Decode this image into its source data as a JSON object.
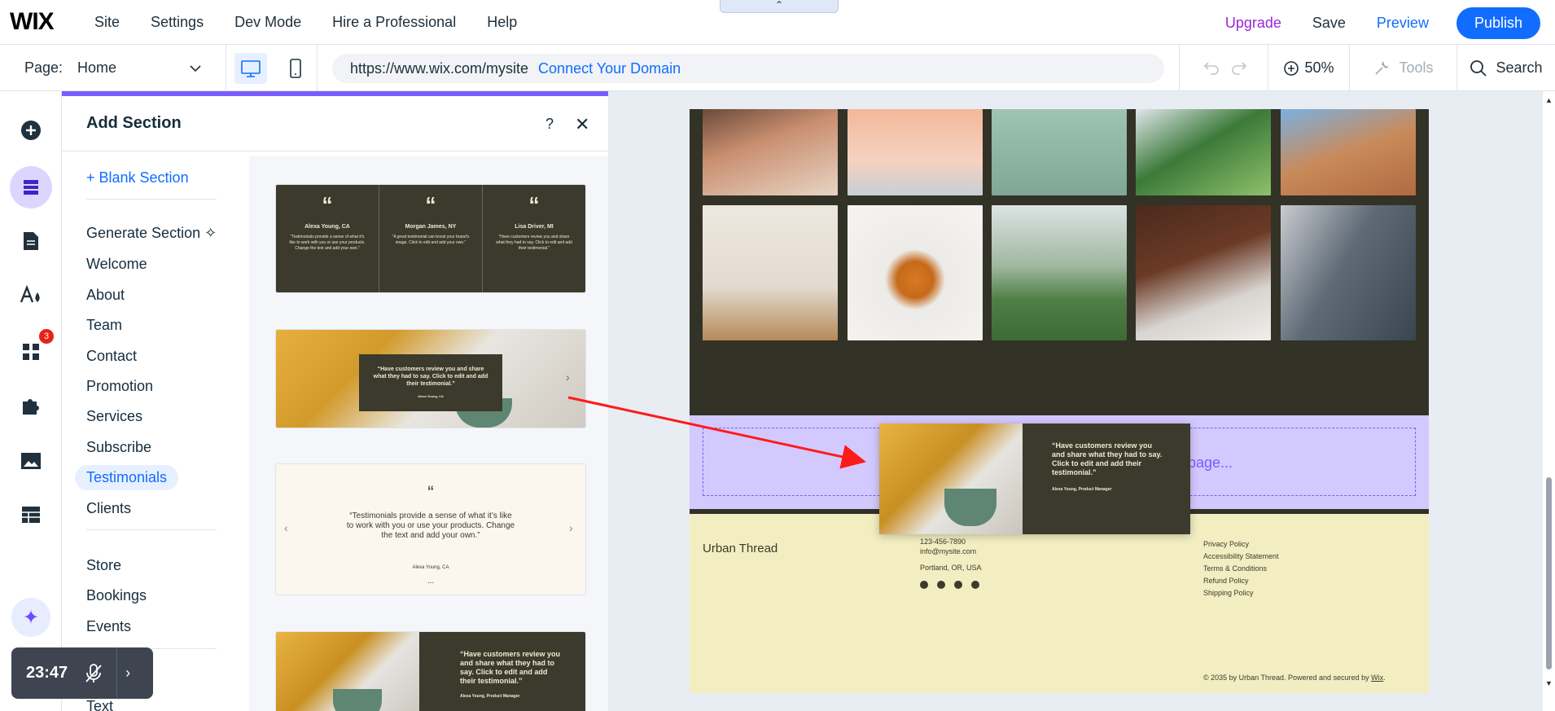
{
  "topbar": {
    "logo": "WIX",
    "menu": [
      "Site",
      "Settings",
      "Dev Mode",
      "Hire a Professional",
      "Help"
    ],
    "upgrade": "Upgrade",
    "save": "Save",
    "preview": "Preview",
    "publish": "Publish"
  },
  "bar2": {
    "page_label": "Page:",
    "page_value": "Home",
    "url": "https://www.wix.com/mysite",
    "connect_domain": "Connect Your Domain",
    "zoom": "50%",
    "tools": "Tools",
    "search": "Search"
  },
  "rail": {
    "apps_badge": "3"
  },
  "panel": {
    "title": "Add Section",
    "help": "?",
    "close": "✕",
    "blank": "+ Blank Section",
    "categories": [
      "Generate Section",
      "Welcome",
      "About",
      "Team",
      "Contact",
      "Promotion",
      "Services",
      "Subscribe",
      "Testimonials",
      "Clients",
      "Store",
      "Bookings",
      "Events",
      "Text"
    ],
    "active_category": "Testimonials"
  },
  "thumbs": {
    "t1": {
      "cols": [
        {
          "quote": "“",
          "name": "Alexa Young, CA",
          "text": "“Testimonials provide a sense of what it’s like to work with you or use your products. Change the text and add your own.”"
        },
        {
          "quote": "“",
          "name": "Morgan James, NY",
          "text": "“A great testimonial can boost your brand’s image. Click to edit and add your own.”"
        },
        {
          "quote": "“",
          "name": "Lisa Driver, MI",
          "text": "“Have customers review you and share what they had to say. Click to edit and add their testimonial.”"
        }
      ]
    },
    "t2": {
      "text": "“Have customers review you and share what they had to say. Click to edit and add their testimonial.”",
      "name": "Alexa Young, CA"
    },
    "t3": {
      "quote": "“",
      "text": "“Testimonials provide a sense of what it’s like to work with you or use your products. Change the text and add your own.”",
      "name": "Alexa Young, CA",
      "dots": "..."
    },
    "t4": {
      "text": "“Have customers review you and share what they had to say. Click to edit and add their testimonial.”",
      "name": "Alexa Young, Product Manager"
    }
  },
  "canvas": {
    "drop_hint": "page...",
    "drag": {
      "text": "“Have customers review you and share what they had to say. Click to edit and add their testimonial.”",
      "name": "Alexa Young, Product Manager"
    },
    "footer": {
      "brand": "Urban Thread",
      "phone": "123-456-7890",
      "email": "info@mysite.com",
      "address": "Portland, OR, USA",
      "links": [
        "Privacy Policy",
        "Accessibility Statement",
        "Terms & Conditions",
        "Refund Policy",
        "Shipping Policy"
      ],
      "copyright": "© 2035 by Urban Thread. Powered and secured by",
      "copyright_link": "Wix"
    }
  },
  "timer": {
    "time": "23:47"
  },
  "colors": {
    "accent": "#116dff",
    "panel_accent": "#7a5cff",
    "dark_olive": "#3b3a2c",
    "footer_bg": "#f2eec1",
    "arrow": "#ff0000"
  }
}
